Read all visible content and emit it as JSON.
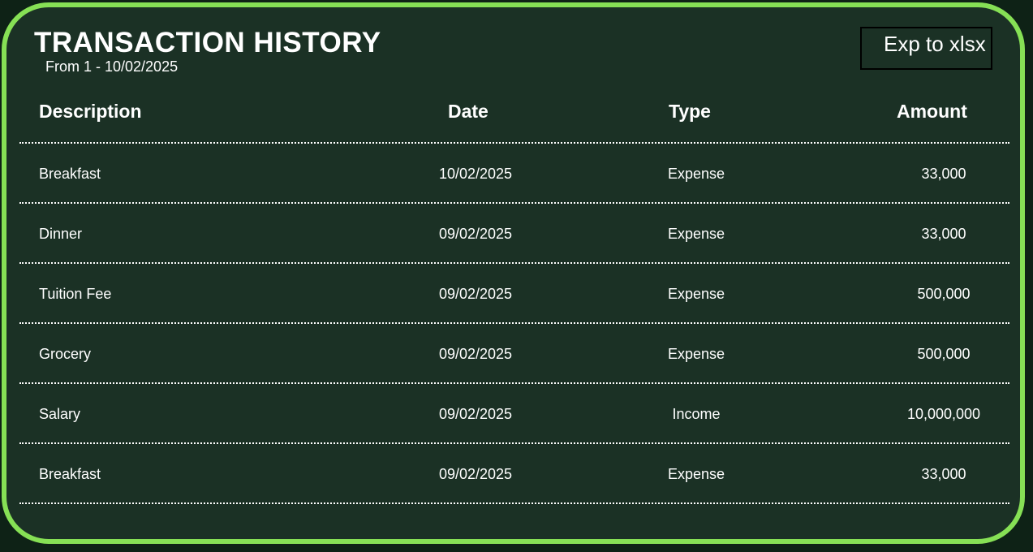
{
  "header": {
    "title": "TRANSACTION HISTORY",
    "subtitle": "From 1 - 10/02/2025",
    "export_label": "Exp to xlsx"
  },
  "table": {
    "columns": [
      "Description",
      "Date",
      "Type",
      "Amount"
    ],
    "rows": [
      {
        "description": "Breakfast",
        "date": "10/02/2025",
        "type": "Expense",
        "amount": "33,000"
      },
      {
        "description": "Dinner",
        "date": "09/02/2025",
        "type": "Expense",
        "amount": "33,000"
      },
      {
        "description": "Tuition Fee",
        "date": "09/02/2025",
        "type": "Expense",
        "amount": "500,000"
      },
      {
        "description": "Grocery",
        "date": "09/02/2025",
        "type": "Expense",
        "amount": "500,000"
      },
      {
        "description": "Salary",
        "date": "09/02/2025",
        "type": "Income",
        "amount": "10,000,000"
      },
      {
        "description": "Breakfast",
        "date": "09/02/2025",
        "type": "Expense",
        "amount": "33,000"
      }
    ]
  },
  "colors": {
    "border": "#86e055",
    "panel_background": "#1b3125",
    "text": "#ffffff"
  }
}
